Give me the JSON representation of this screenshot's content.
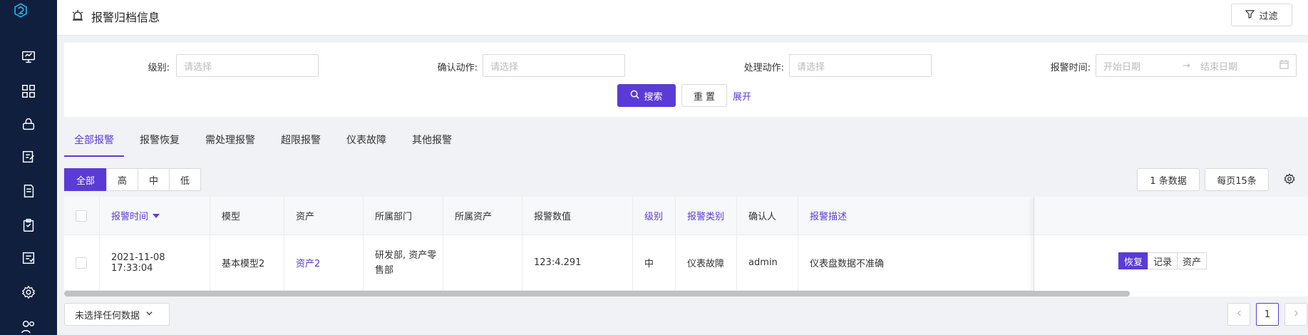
{
  "header": {
    "title": "报警归档信息",
    "filter_label": "过滤"
  },
  "search": {
    "level_label": "级别:",
    "level_placeholder": "请选择",
    "confirm_label": "确认动作:",
    "confirm_placeholder": "请选择",
    "handle_label": "处理动作:",
    "handle_placeholder": "请选择",
    "time_label": "报警时间:",
    "start_placeholder": "开始日期",
    "end_placeholder": "结束日期",
    "search_btn": "搜索",
    "reset_btn": "重 置",
    "expand_link": "展开"
  },
  "tabs": [
    {
      "label": "全部报警",
      "active": true
    },
    {
      "label": "报警恢复"
    },
    {
      "label": "需处理报警"
    },
    {
      "label": "超限报警"
    },
    {
      "label": "仪表故障"
    },
    {
      "label": "其他报警"
    }
  ],
  "levels": [
    "全部",
    "高",
    "中",
    "低"
  ],
  "toolbar": {
    "count": "1 条数据",
    "page_size": "每页15条"
  },
  "table": {
    "headers": [
      "报警时间",
      "模型",
      "资产",
      "所属部门",
      "所属资产",
      "报警数值",
      "级别",
      "报警类别",
      "确认人",
      "报警描述"
    ],
    "rows": [
      {
        "time": "2021-11-08 17:33:04",
        "model": "基本模型2",
        "asset": "资产2",
        "dept_line1": "研发部, 资产零",
        "dept_line2": "售部",
        "owner_asset": "",
        "value": "123:4.291",
        "level": "中",
        "category": "仪表故障",
        "confirmer": "admin",
        "desc": "仪表盘数据不准确",
        "ops": [
          "恢复",
          "记录",
          "资产"
        ]
      }
    ]
  },
  "footer": {
    "select_label": "未选择任何数据",
    "current_page": "1"
  },
  "colors": {
    "primary": "#5b3bd6",
    "sidebar": "#0f1f3d"
  }
}
